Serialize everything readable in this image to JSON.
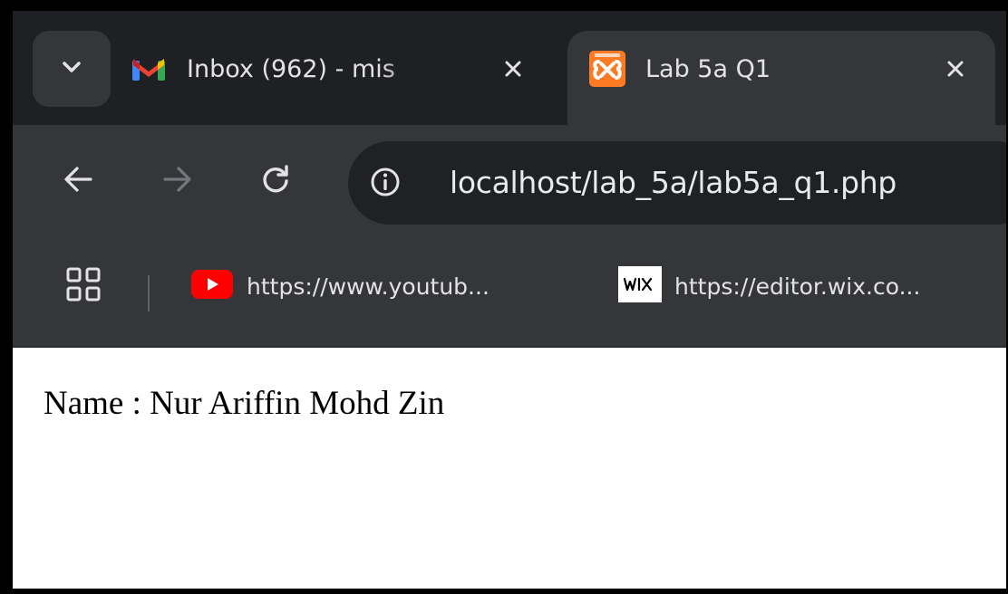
{
  "tabs": [
    {
      "title": "Inbox (962) - mis",
      "icon": "gmail-icon",
      "active": false
    },
    {
      "title": "Lab 5a Q1",
      "icon": "xampp-icon",
      "active": true
    }
  ],
  "toolbar": {
    "url": "localhost/lab_5a/lab5a_q1.php"
  },
  "bookmarks": [
    {
      "label": "https://www.youtub...",
      "icon": "youtube-icon"
    },
    {
      "label": "https://editor.wix.co...",
      "icon": "wix-icon"
    }
  ],
  "page": {
    "text": "Name : Nur Ariffin Mohd Zin"
  },
  "colors": {
    "tabstrip": "#1f2024",
    "toolbar": "#35363a",
    "omnibox": "#202124",
    "xampp_orange": "#fb7a24",
    "youtube_red": "#ff0000"
  }
}
